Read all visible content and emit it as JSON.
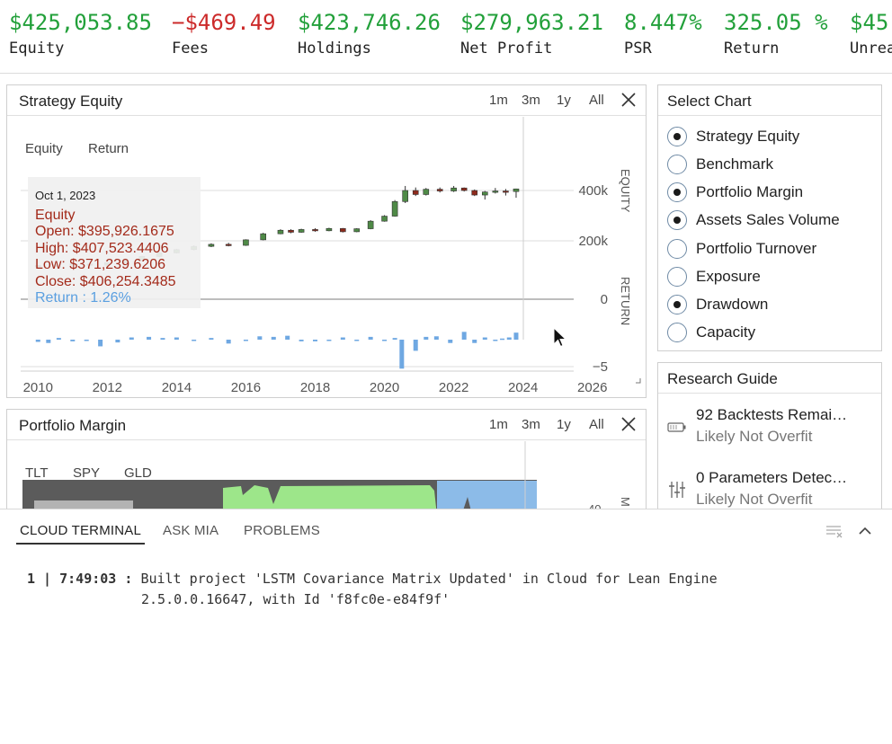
{
  "stats": [
    {
      "value": "$425,053.85",
      "label": "Equity",
      "negative": false
    },
    {
      "value": "−$469.49",
      "label": "Fees",
      "negative": true
    },
    {
      "value": "$423,746.26",
      "label": "Holdings",
      "negative": false
    },
    {
      "value": "$279,963.21",
      "label": "Net Profit",
      "negative": false
    },
    {
      "value": "8.447%",
      "label": "PSR",
      "negative": false
    },
    {
      "value": "325.05 %",
      "label": "Return",
      "negative": false
    },
    {
      "value": "$45,",
      "label": "Unrea",
      "negative": false
    }
  ],
  "equity_panel": {
    "title": "Strategy Equity",
    "ranges": [
      "1m",
      "3m",
      "1y",
      "All"
    ],
    "legend": [
      "Equity",
      "Return"
    ],
    "axis_right_top": "EQUITY",
    "axis_right_bottom": "RETURN",
    "tooltip": {
      "date": "Oct 1, 2023",
      "series": "Equity",
      "open": "Open: $395,926.1675",
      "high": "High: $407,523.4406",
      "low": "Low: $371,239.6206",
      "close": "Close: $406,254.3485",
      "return": "Return : 1.26%"
    }
  },
  "chart_data": {
    "type": "line",
    "title": "Strategy Equity",
    "x_ticks": [
      "2010",
      "2012",
      "2014",
      "2016",
      "2018",
      "2020",
      "2022",
      "2024",
      "2026"
    ],
    "equity_ticks": [
      "400k",
      "200k"
    ],
    "return_ticks": [
      "0",
      "−5"
    ],
    "xlim": [
      2009.5,
      2026.5
    ],
    "equity_ylim": [
      0,
      450000
    ],
    "return_ylim": [
      -6,
      3
    ],
    "equity_candles": [
      {
        "x": 2010.0,
        "o": 100000,
        "h": 103000,
        "l": 98000,
        "c": 102000
      },
      {
        "x": 2010.5,
        "o": 102000,
        "h": 106000,
        "l": 99000,
        "c": 104000
      },
      {
        "x": 2011.0,
        "o": 104000,
        "h": 110000,
        "l": 102000,
        "c": 108000
      },
      {
        "x": 2011.5,
        "o": 108000,
        "h": 112000,
        "l": 100000,
        "c": 103000
      },
      {
        "x": 2012.0,
        "o": 103000,
        "h": 115000,
        "l": 101000,
        "c": 113000
      },
      {
        "x": 2012.5,
        "o": 113000,
        "h": 125000,
        "l": 110000,
        "c": 122000
      },
      {
        "x": 2013.0,
        "o": 122000,
        "h": 140000,
        "l": 120000,
        "c": 138000
      },
      {
        "x": 2013.5,
        "o": 138000,
        "h": 155000,
        "l": 135000,
        "c": 152000
      },
      {
        "x": 2014.0,
        "o": 152000,
        "h": 168000,
        "l": 150000,
        "c": 165000
      },
      {
        "x": 2014.5,
        "o": 165000,
        "h": 182000,
        "l": 162000,
        "c": 178000
      },
      {
        "x": 2015.0,
        "o": 178000,
        "h": 190000,
        "l": 175000,
        "c": 186000
      },
      {
        "x": 2015.5,
        "o": 186000,
        "h": 192000,
        "l": 178000,
        "c": 182000
      },
      {
        "x": 2016.0,
        "o": 182000,
        "h": 206000,
        "l": 180000,
        "c": 204000
      },
      {
        "x": 2016.5,
        "o": 204000,
        "h": 232000,
        "l": 202000,
        "c": 228000
      },
      {
        "x": 2017.0,
        "o": 228000,
        "h": 246000,
        "l": 226000,
        "c": 242000
      },
      {
        "x": 2017.3,
        "o": 242000,
        "h": 246000,
        "l": 230000,
        "c": 234000
      },
      {
        "x": 2017.6,
        "o": 234000,
        "h": 248000,
        "l": 232000,
        "c": 245000
      },
      {
        "x": 2018.0,
        "o": 245000,
        "h": 250000,
        "l": 236000,
        "c": 240000
      },
      {
        "x": 2018.4,
        "o": 240000,
        "h": 252000,
        "l": 238000,
        "c": 249000
      },
      {
        "x": 2018.8,
        "o": 249000,
        "h": 251000,
        "l": 233000,
        "c": 236000
      },
      {
        "x": 2019.2,
        "o": 236000,
        "h": 250000,
        "l": 234000,
        "c": 248000
      },
      {
        "x": 2019.6,
        "o": 248000,
        "h": 282000,
        "l": 246000,
        "c": 278000
      },
      {
        "x": 2020.0,
        "o": 278000,
        "h": 302000,
        "l": 276000,
        "c": 298000
      },
      {
        "x": 2020.3,
        "o": 298000,
        "h": 362000,
        "l": 296000,
        "c": 356000
      },
      {
        "x": 2020.6,
        "o": 356000,
        "h": 418000,
        "l": 350000,
        "c": 400000
      },
      {
        "x": 2020.9,
        "o": 400000,
        "h": 412000,
        "l": 378000,
        "c": 384000
      },
      {
        "x": 2021.2,
        "o": 384000,
        "h": 410000,
        "l": 380000,
        "c": 405000
      },
      {
        "x": 2021.6,
        "o": 405000,
        "h": 412000,
        "l": 392000,
        "c": 398000
      },
      {
        "x": 2022.0,
        "o": 398000,
        "h": 418000,
        "l": 394000,
        "c": 410000
      },
      {
        "x": 2022.3,
        "o": 410000,
        "h": 412000,
        "l": 396000,
        "c": 400000
      },
      {
        "x": 2022.6,
        "o": 400000,
        "h": 404000,
        "l": 378000,
        "c": 382000
      },
      {
        "x": 2022.9,
        "o": 382000,
        "h": 398000,
        "l": 364000,
        "c": 394000
      },
      {
        "x": 2023.2,
        "o": 394000,
        "h": 410000,
        "l": 388000,
        "c": 398000
      },
      {
        "x": 2023.5,
        "o": 398000,
        "h": 406000,
        "l": 380000,
        "c": 396000
      },
      {
        "x": 2023.8,
        "o": 395926,
        "h": 407523,
        "l": 371240,
        "c": 406254
      }
    ],
    "return_bars": [
      {
        "x": 2010.0,
        "v": -0.4
      },
      {
        "x": 2010.3,
        "v": -0.6
      },
      {
        "x": 2010.6,
        "v": 0.3
      },
      {
        "x": 2011.0,
        "v": -0.3
      },
      {
        "x": 2011.4,
        "v": -0.2
      },
      {
        "x": 2011.8,
        "v": -1.2
      },
      {
        "x": 2012.3,
        "v": -0.5
      },
      {
        "x": 2012.7,
        "v": 0.4
      },
      {
        "x": 2013.2,
        "v": 0.5
      },
      {
        "x": 2013.6,
        "v": 0.3
      },
      {
        "x": 2014.0,
        "v": 0.4
      },
      {
        "x": 2014.5,
        "v": -0.2
      },
      {
        "x": 2015.0,
        "v": 0.3
      },
      {
        "x": 2015.5,
        "v": -0.7
      },
      {
        "x": 2016.0,
        "v": -0.2
      },
      {
        "x": 2016.4,
        "v": 0.6
      },
      {
        "x": 2016.8,
        "v": 0.5
      },
      {
        "x": 2017.2,
        "v": 0.7
      },
      {
        "x": 2017.6,
        "v": -0.3
      },
      {
        "x": 2018.0,
        "v": -0.3
      },
      {
        "x": 2018.4,
        "v": -0.2
      },
      {
        "x": 2018.8,
        "v": 0.4
      },
      {
        "x": 2019.2,
        "v": -0.2
      },
      {
        "x": 2019.6,
        "v": 0.5
      },
      {
        "x": 2020.0,
        "v": -0.2
      },
      {
        "x": 2020.3,
        "v": 0.3
      },
      {
        "x": 2020.5,
        "v": -5.2
      },
      {
        "x": 2020.9,
        "v": -2.0
      },
      {
        "x": 2021.2,
        "v": 0.5
      },
      {
        "x": 2021.5,
        "v": 0.6
      },
      {
        "x": 2021.9,
        "v": -0.6
      },
      {
        "x": 2022.3,
        "v": 1.4
      },
      {
        "x": 2022.6,
        "v": -0.6
      },
      {
        "x": 2022.9,
        "v": 0.4
      },
      {
        "x": 2023.2,
        "v": -0.2
      },
      {
        "x": 2023.4,
        "v": 0.2
      },
      {
        "x": 2023.6,
        "v": 0.4
      },
      {
        "x": 2023.8,
        "v": 1.26
      }
    ]
  },
  "select_chart": {
    "title": "Select Chart",
    "options": [
      {
        "label": "Strategy Equity",
        "checked": true
      },
      {
        "label": "Benchmark",
        "checked": false
      },
      {
        "label": "Portfolio Margin",
        "checked": true
      },
      {
        "label": "Assets Sales Volume",
        "checked": true
      },
      {
        "label": "Portfolio Turnover",
        "checked": false
      },
      {
        "label": "Exposure",
        "checked": false
      },
      {
        "label": "Drawdown",
        "checked": true
      },
      {
        "label": "Capacity",
        "checked": false
      }
    ]
  },
  "research_guide": {
    "title": "Research Guide",
    "items": [
      {
        "title": "92 Backtests Remai…",
        "subtitle": "Likely Not Overfit",
        "icon": "battery-icon"
      },
      {
        "title": "0 Parameters Detec…",
        "subtitle": "Likely Not Overfit",
        "icon": "sliders-icon"
      }
    ]
  },
  "margin_panel": {
    "title": "Portfolio Margin",
    "ranges": [
      "1m",
      "3m",
      "1y",
      "All"
    ],
    "legend": [
      "TLT",
      "SPY",
      "GLD"
    ],
    "partial_tick": "40",
    "partial_axis": "M"
  },
  "terminal": {
    "tabs": [
      "CLOUD TERMINAL",
      "ASK MIA",
      "PROBLEMS"
    ],
    "line_no": "1",
    "time": "7:49:03",
    "message_1": "Built project 'LSTM Covariance Matrix Updated' in Cloud for Lean Engine",
    "message_2": "2.5.0.0.16647, with Id 'f8fc0e-e84f9f'"
  },
  "colors": {
    "positive": "#22a03a",
    "negative": "#cc2a2a",
    "candle_up": "#4f8a47",
    "candle_down": "#8f2a1c",
    "return_bar": "#6fa8e2",
    "margin_dark": "#5b5b5b",
    "margin_green": "#9de68a",
    "margin_blue": "#8cbbe8"
  }
}
